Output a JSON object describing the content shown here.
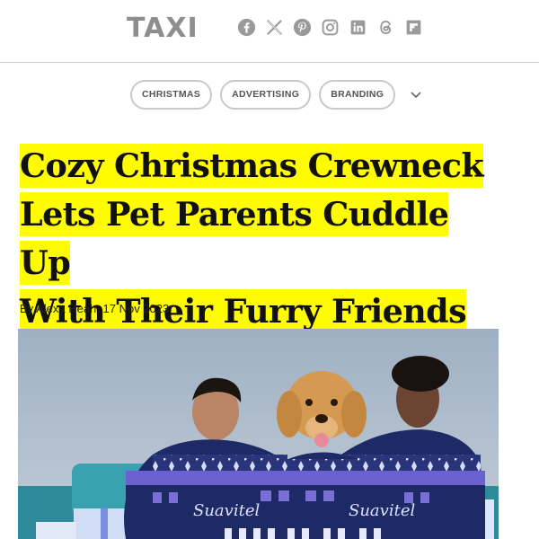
{
  "site": {
    "logo": "TAXI"
  },
  "social_icons": [
    "facebook-icon",
    "x-icon",
    "pinterest-icon",
    "instagram-icon",
    "linkedin-icon",
    "threads-icon",
    "flipboard-icon"
  ],
  "tags": [
    "CHRISTMAS",
    "ADVERTISING",
    "BRANDING"
  ],
  "article": {
    "title_lines": [
      "Cozy Christmas Crewneck",
      "Lets Pet Parents Cuddle Up",
      "With Their Furry Friends"
    ],
    "byline": "By Alexa Heah, 17 Nov 2023"
  },
  "hero": {
    "sweater_text": "Suavitel"
  },
  "colors": {
    "highlight": "#fffb00",
    "logo_gray": "#8e8e8e",
    "sweater_navy": "#1e2a66",
    "sweater_purple": "#7a6fd6"
  }
}
